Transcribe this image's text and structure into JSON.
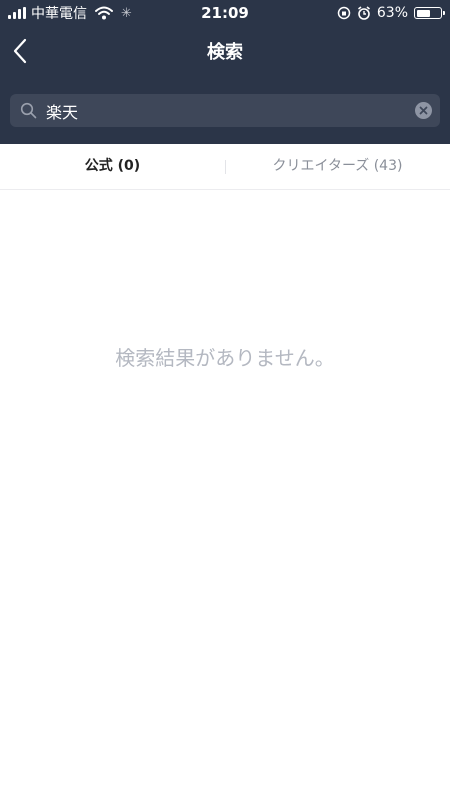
{
  "status_bar": {
    "carrier": "中華電信",
    "time": "21:09",
    "battery_percent": "63%",
    "battery_level": 0.63
  },
  "nav": {
    "title": "検索"
  },
  "search": {
    "value": "楽天"
  },
  "tabs": [
    {
      "label": "公式 (0)",
      "selected": true
    },
    {
      "label": "クリエイターズ (43)",
      "selected": false
    }
  ],
  "empty_message": "検索結果がありません。",
  "colors": {
    "header_bg": "#2b3548",
    "search_bg": "#3e4759",
    "placeholder_text": "#b4b8c1"
  }
}
